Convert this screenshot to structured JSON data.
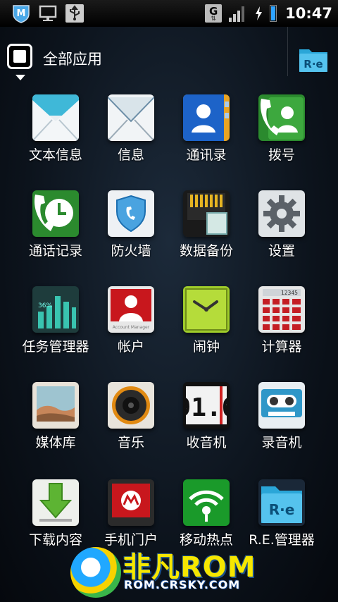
{
  "status_bar": {
    "icons_left": [
      "shield-m-icon",
      "monitor-icon",
      "usb-icon"
    ],
    "network_type": "G",
    "time": "10:47"
  },
  "header": {
    "title": "全部应用"
  },
  "apps": [
    {
      "label": "文本信息",
      "icon": "message-envelope-icon"
    },
    {
      "label": "信息",
      "icon": "email-envelope-icon"
    },
    {
      "label": "通讯录",
      "icon": "contacts-icon"
    },
    {
      "label": "拨号",
      "icon": "phone-dialer-icon"
    },
    {
      "label": "通话记录",
      "icon": "call-log-icon"
    },
    {
      "label": "防火墙",
      "icon": "firewall-shield-icon"
    },
    {
      "label": "数据备份",
      "icon": "sd-card-backup-icon"
    },
    {
      "label": "设置",
      "icon": "settings-gear-icon"
    },
    {
      "label": "任务管理器",
      "icon": "task-manager-icon"
    },
    {
      "label": "帐户",
      "icon": "account-icon"
    },
    {
      "label": "闹钟",
      "icon": "alarm-clock-icon"
    },
    {
      "label": "计算器",
      "icon": "calculator-icon"
    },
    {
      "label": "媒体库",
      "icon": "media-gallery-icon"
    },
    {
      "label": "音乐",
      "icon": "music-speaker-icon"
    },
    {
      "label": "收音机",
      "icon": "radio-icon"
    },
    {
      "label": "录音机",
      "icon": "voice-recorder-icon"
    },
    {
      "label": "下载内容",
      "icon": "download-icon"
    },
    {
      "label": "手机门户",
      "icon": "motorola-portal-icon"
    },
    {
      "label": "移动热点",
      "icon": "wifi-hotspot-icon"
    },
    {
      "label": "R.E.管理器",
      "icon": "re-folder-icon"
    }
  ],
  "watermark": {
    "brand": "非凡ROM",
    "url": "ROM.CRSKY.COM"
  },
  "colors": {
    "accent_blue": "#2ea3ff",
    "background": "#0c131c"
  }
}
